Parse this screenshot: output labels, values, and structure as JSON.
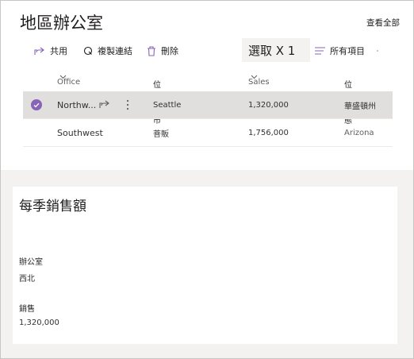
{
  "header": {
    "title": "地區辦公室",
    "view_all": "查看全部"
  },
  "commands": {
    "share": "共用",
    "copy_link": "複製連結",
    "delete": "刪除",
    "selection": "選取 X 1",
    "all_items": "所有項目"
  },
  "columns": {
    "office": "Office",
    "city": "位置: 縣市",
    "sales": "Sales",
    "state": "位置: 狀態"
  },
  "rows": [
    {
      "office": "Northw...",
      "city": "Seattle",
      "sales": "1,320,000",
      "state": "華盛頓州",
      "selected": true
    },
    {
      "office": "Southwest",
      "city": "菩販",
      "sales": "1,756,000",
      "state": "Arizona",
      "selected": false
    }
  ],
  "detail_card": {
    "title": "每季銷售額",
    "office_label": "辦公室",
    "office_value": "西北",
    "sales_label": "銷售",
    "sales_value": "1,320,000"
  },
  "colors": {
    "accent": "#8764b8",
    "selected_row": "#e1dfdd",
    "background": "#f3f2f1"
  },
  "icons": {
    "share": "share-icon",
    "copy_link": "link-icon",
    "delete": "trash-icon",
    "all_items": "list-view-icon",
    "sort": "chevron-down-icon",
    "check": "checkmark-icon",
    "more": "more-vertical-icon"
  }
}
